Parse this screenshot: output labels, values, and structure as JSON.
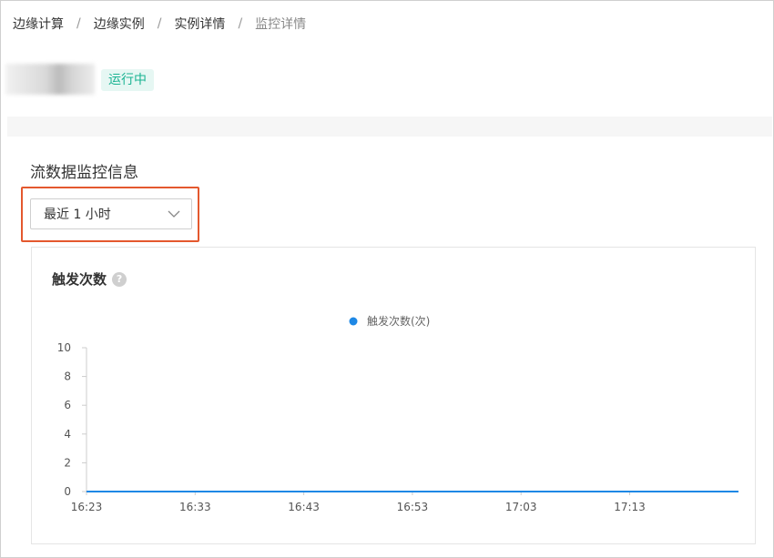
{
  "breadcrumb": {
    "items": [
      "边缘计算",
      "边缘实例",
      "实例详情"
    ],
    "separator": "/",
    "current": "监控详情"
  },
  "instance": {
    "status": "运行中"
  },
  "section": {
    "title": "流数据监控信息"
  },
  "time_range": {
    "selected": "最近 1 小时"
  },
  "chart": {
    "title": "触发次数",
    "help_icon": "question-icon"
  },
  "colors": {
    "accent": "#1e88e5",
    "status_bg": "#e6f7f3",
    "status_text": "#19b392",
    "highlight": "#e4582e"
  },
  "chart_data": {
    "type": "line",
    "series": [
      {
        "name": "触发次数(次)",
        "values": [
          0,
          0,
          0,
          0,
          0,
          0,
          0
        ]
      }
    ],
    "x": [
      "16:23",
      "16:33",
      "16:43",
      "16:53",
      "17:03",
      "17:13",
      ""
    ],
    "x_ticks": [
      "16:23",
      "16:33",
      "16:43",
      "16:53",
      "17:03",
      "17:13"
    ],
    "y_ticks": [
      0,
      2,
      4,
      6,
      8,
      10
    ],
    "ylim": [
      0,
      10
    ],
    "legend": "top-center",
    "grid": false
  }
}
